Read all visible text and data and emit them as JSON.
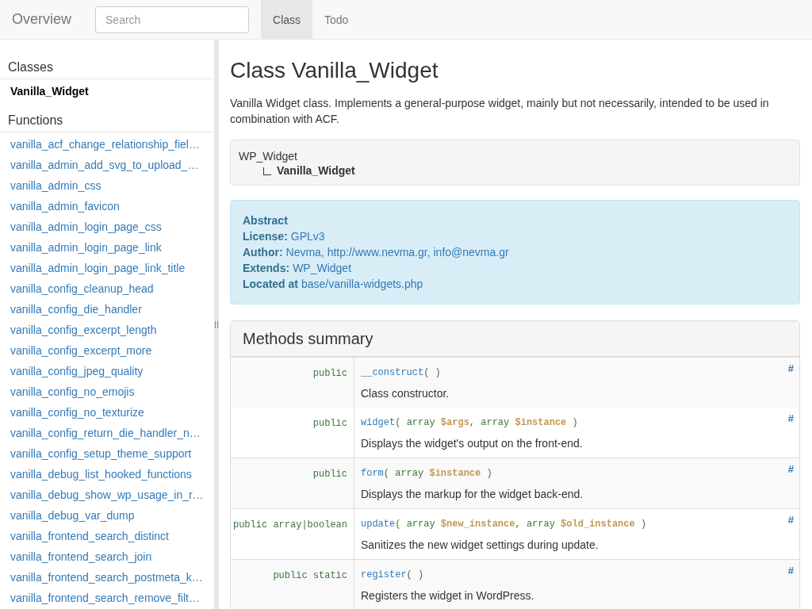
{
  "navbar": {
    "brand": "Overview",
    "search": {
      "placeholder": "Search"
    },
    "tabs": [
      {
        "label": "Class",
        "selected": true
      },
      {
        "label": "Todo",
        "selected": false
      }
    ]
  },
  "sidebar": {
    "sections": [
      {
        "title": "Classes",
        "items": [
          {
            "label": "Vanilla_Widget",
            "selected": true
          }
        ]
      },
      {
        "title": "Functions",
        "items": [
          {
            "label": "vanilla_acf_change_relationship_fiel…",
            "selected": false
          },
          {
            "label": "vanilla_admin_add_svg_to_upload_…",
            "selected": false
          },
          {
            "label": "vanilla_admin_css",
            "selected": false
          },
          {
            "label": "vanilla_admin_favicon",
            "selected": false
          },
          {
            "label": "vanilla_admin_login_page_css",
            "selected": false
          },
          {
            "label": "vanilla_admin_login_page_link",
            "selected": false
          },
          {
            "label": "vanilla_admin_login_page_link_title",
            "selected": false
          },
          {
            "label": "vanilla_config_cleanup_head",
            "selected": false
          },
          {
            "label": "vanilla_config_die_handler",
            "selected": false
          },
          {
            "label": "vanilla_config_excerpt_length",
            "selected": false
          },
          {
            "label": "vanilla_config_excerpt_more",
            "selected": false
          },
          {
            "label": "vanilla_config_jpeg_quality",
            "selected": false
          },
          {
            "label": "vanilla_config_no_emojis",
            "selected": false
          },
          {
            "label": "vanilla_config_no_texturize",
            "selected": false
          },
          {
            "label": "vanilla_config_return_die_handler_n…",
            "selected": false
          },
          {
            "label": "vanilla_config_setup_theme_support",
            "selected": false
          },
          {
            "label": "vanilla_debug_list_hooked_functions",
            "selected": false
          },
          {
            "label": "vanilla_debug_show_wp_usage_in_r…",
            "selected": false
          },
          {
            "label": "vanilla_debug_var_dump",
            "selected": false
          },
          {
            "label": "vanilla_frontend_search_distinct",
            "selected": false
          },
          {
            "label": "vanilla_frontend_search_join",
            "selected": false
          },
          {
            "label": "vanilla_frontend_search_postmeta_k…",
            "selected": false
          },
          {
            "label": "vanilla_frontend_search_remove_filt…",
            "selected": false
          }
        ]
      }
    ]
  },
  "content": {
    "title": "Class Vanilla_Widget",
    "description": "Vanilla Widget class. Implements a general-purpose widget, mainly but not necessarily, intended to be used in combination with ACF.",
    "hierarchy": {
      "parent": "WP_Widget",
      "child": "Vanilla_Widget"
    },
    "info": {
      "heading": "Abstract",
      "lines": [
        {
          "label": "License:",
          "value": "GPLv3"
        },
        {
          "label": "Author:",
          "value": "Nevma, http://www.nevma.gr, info@nevma.gr"
        },
        {
          "label": "Extends:",
          "value": "WP_Widget"
        },
        {
          "label": "Located at",
          "value": "base/vanilla-widgets.php"
        }
      ]
    },
    "methods": {
      "title": "Methods summary",
      "rows": [
        {
          "modifiers": "public",
          "signature": [
            {
              "kind": "name",
              "text": "__construct"
            },
            {
              "kind": "punct",
              "text": "( )"
            }
          ],
          "description": "Class constructor.",
          "anchor": "#"
        },
        {
          "modifiers": "public",
          "signature": [
            {
              "kind": "name",
              "text": "widget"
            },
            {
              "kind": "punct",
              "text": "( "
            },
            {
              "kind": "type",
              "text": "array "
            },
            {
              "kind": "var",
              "text": "$args"
            },
            {
              "kind": "punct",
              "text": ", "
            },
            {
              "kind": "type",
              "text": "array "
            },
            {
              "kind": "var",
              "text": "$instance"
            },
            {
              "kind": "punct",
              "text": " )"
            }
          ],
          "description": "Displays the widget's output on the front-end.",
          "anchor": "#"
        },
        {
          "modifiers": "public",
          "signature": [
            {
              "kind": "name",
              "text": "form"
            },
            {
              "kind": "punct",
              "text": "( "
            },
            {
              "kind": "type",
              "text": "array "
            },
            {
              "kind": "var",
              "text": "$instance"
            },
            {
              "kind": "punct",
              "text": " )"
            }
          ],
          "description": "Displays the markup for the widget back-end.",
          "anchor": "#"
        },
        {
          "modifiers": "public array|boolean",
          "signature": [
            {
              "kind": "name",
              "text": "update"
            },
            {
              "kind": "punct",
              "text": "( "
            },
            {
              "kind": "type",
              "text": "array "
            },
            {
              "kind": "var",
              "text": "$new_instance"
            },
            {
              "kind": "punct",
              "text": ", "
            },
            {
              "kind": "type",
              "text": "array "
            },
            {
              "kind": "var",
              "text": "$old_instance"
            },
            {
              "kind": "punct",
              "text": " )"
            }
          ],
          "description": "Sanitizes the new widget settings during update.",
          "anchor": "#"
        },
        {
          "modifiers": "public static",
          "signature": [
            {
              "kind": "name",
              "text": "register"
            },
            {
              "kind": "punct",
              "text": "( )"
            }
          ],
          "description": "Registers the widget in WordPress.",
          "anchor": "#"
        }
      ]
    }
  }
}
